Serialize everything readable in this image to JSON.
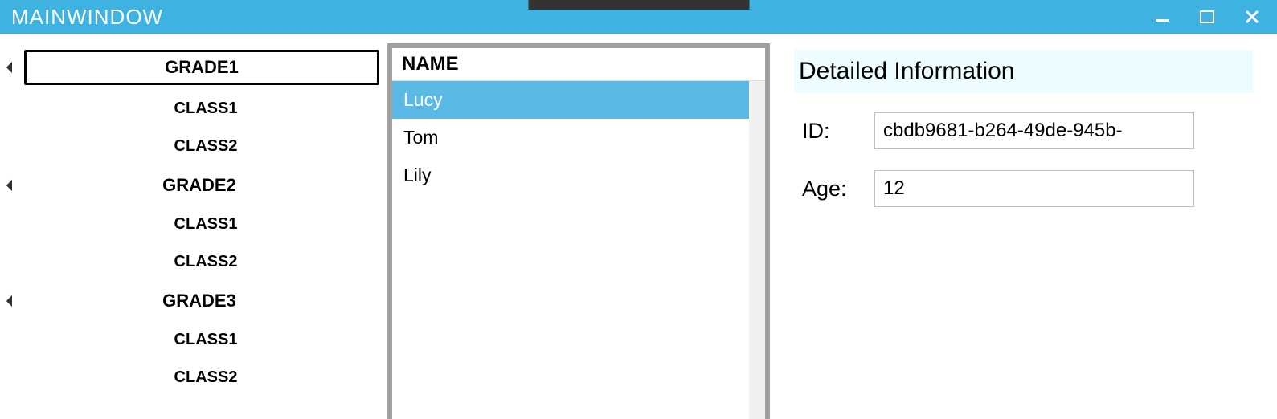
{
  "window": {
    "title": "MAINWINDOW"
  },
  "tree": {
    "grades": [
      {
        "label": "GRADE1",
        "selected": true,
        "classes": [
          {
            "label": "CLASS1"
          },
          {
            "label": "CLASS2"
          }
        ]
      },
      {
        "label": "GRADE2",
        "selected": false,
        "classes": [
          {
            "label": "CLASS1"
          },
          {
            "label": "CLASS2"
          }
        ]
      },
      {
        "label": "GRADE3",
        "selected": false,
        "classes": [
          {
            "label": "CLASS1"
          },
          {
            "label": "CLASS2"
          }
        ]
      }
    ]
  },
  "list": {
    "header": "NAME",
    "items": [
      {
        "name": "Lucy",
        "selected": true
      },
      {
        "name": "Tom",
        "selected": false
      },
      {
        "name": "Lily",
        "selected": false
      }
    ]
  },
  "detail": {
    "header": "Detailed Information",
    "id_label": "ID:",
    "id_value": "cbdb9681-b264-49de-945b-",
    "age_label": "Age:",
    "age_value": "12"
  }
}
